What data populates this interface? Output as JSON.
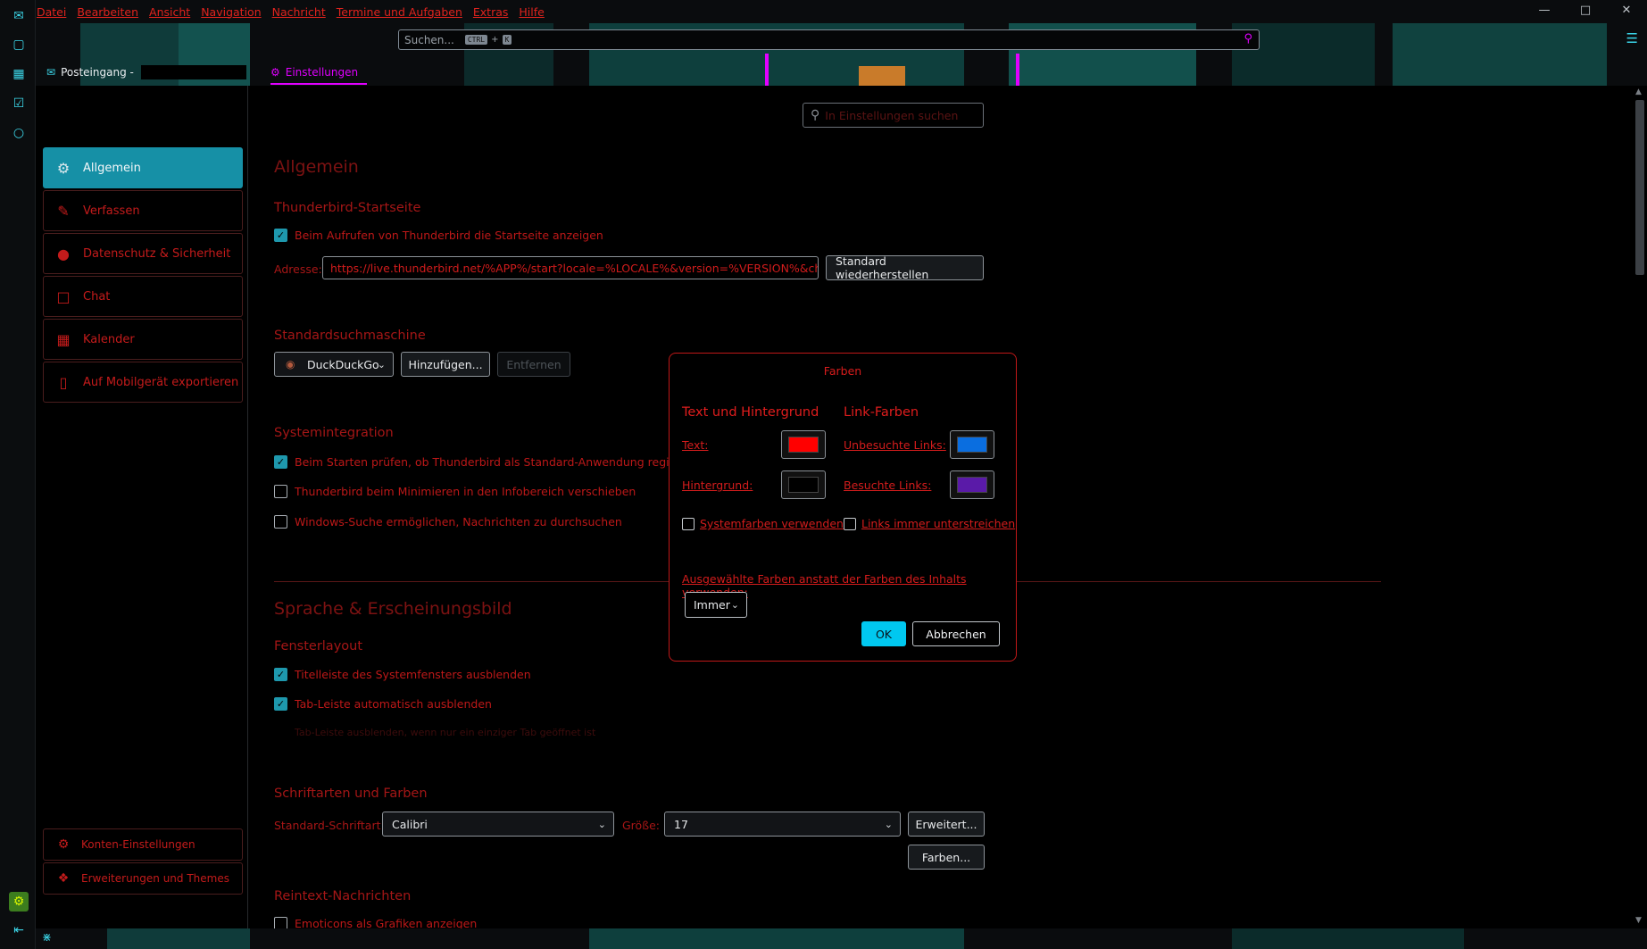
{
  "menubar": [
    "Datei",
    "Bearbeiten",
    "Ansicht",
    "Navigation",
    "Nachricht",
    "Termine und Aufgaben",
    "Extras",
    "Hilfe"
  ],
  "search": {
    "placeholder": "Suchen...",
    "key1": "CTRL",
    "plus": "+",
    "key2": "K"
  },
  "tabs": {
    "inbox": "Posteingang -",
    "settings": "Einstellungen"
  },
  "prefs_search_placeholder": "In Einstellungen suchen",
  "sidebar": {
    "items": [
      "Allgemein",
      "Verfassen",
      "Datenschutz & Sicherheit",
      "Chat",
      "Kalender",
      "Auf Mobilgerät exportieren"
    ],
    "bottom": [
      "Konten-Einstellungen",
      "Erweiterungen und Themes"
    ]
  },
  "general": {
    "title": "Allgemein",
    "start_heading": "Thunderbird-Startseite",
    "start_check": "Beim Aufrufen von Thunderbird die Startseite anzeigen",
    "address_label": "Adresse:",
    "address_value": "https://live.thunderbird.net/%APP%/start?locale=%LOCALE%&version=%VERSION%&channel",
    "restore_button": "Standard wiederherstellen",
    "search_heading": "Standardsuchmaschine",
    "engine": "DuckDuckGo",
    "add_button": "Hinzufügen...",
    "remove_button": "Entfernen",
    "sys_heading": "Systemintegration",
    "sys_check1": "Beim Starten prüfen, ob Thunderbird als Standard-Anwendung registriert",
    "sys_check2": "Thunderbird beim Minimieren in den Infobereich verschieben",
    "sys_check3": "Windows-Suche ermöglichen, Nachrichten zu durchsuchen"
  },
  "appearance": {
    "title": "Sprache & Erscheinungsbild",
    "layout_heading": "Fensterlayout",
    "layout_check1": "Titelleiste des Systemfensters ausblenden",
    "layout_check2": "Tab-Leiste automatisch ausblenden",
    "layout_note": "Tab-Leiste ausblenden, wenn nur ein einziger Tab geöffnet ist",
    "fonts_heading": "Schriftarten und Farben",
    "font_label": "Standard-Schriftart:",
    "font_value": "Calibri",
    "size_label": "Größe:",
    "size_value": "17",
    "advanced_button": "Erweitert...",
    "colors_button": "Farben...",
    "plain_heading": "Reintext-Nachrichten",
    "plain_check": "Emoticons als Grafiken anzeigen"
  },
  "dialog": {
    "title": "Farben",
    "text_bg_heading": "Text und Hintergrund",
    "link_heading": "Link-Farben",
    "text_label": "Text:",
    "bg_label": "Hintergrund:",
    "unvisited_label": "Unbesuchte Links:",
    "visited_label": "Besuchte Links:",
    "system_colors": "Systemfarben verwenden",
    "underline_links": "Links immer unterstreichen",
    "override_label": "Ausgewählte Farben anstatt der Farben des Inhalts verwenden:",
    "override_value": "Immer",
    "ok": "OK",
    "cancel": "Abbrechen",
    "colors": {
      "text": "#ff0000",
      "background": "#000000",
      "unvisited": "#0a6ee0",
      "visited": "#5a1aa8"
    }
  },
  "colors": {
    "accent": "#1690a6",
    "danger": "#d81c1c",
    "magenta": "#e000ff"
  }
}
